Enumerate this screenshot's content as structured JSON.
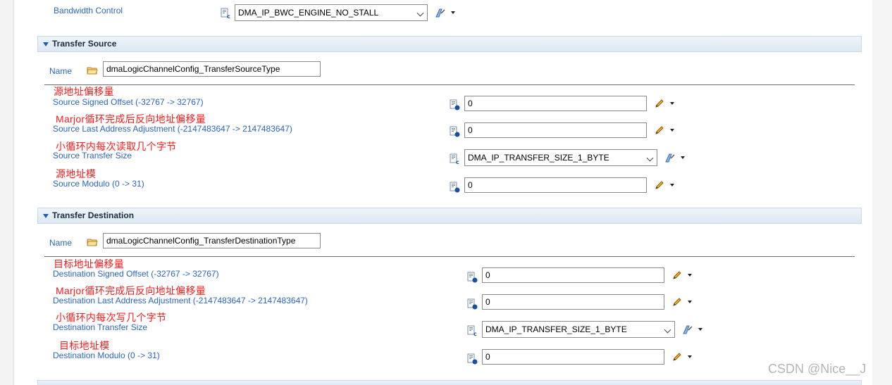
{
  "top": {
    "bandwidth_label": "Bandwidth Control",
    "bandwidth_value": "DMA_IP_BWC_ENGINE_NO_STALL"
  },
  "source": {
    "header": "Transfer Source",
    "name_label": "Name",
    "name_value": "dmaLogicChannelConfig_TransferSourceType",
    "fields": [
      {
        "note": "源地址偏移量",
        "label": "Source Signed Offset (-32767 -> 32767)",
        "value": "0"
      },
      {
        "note": "Marjor循环完成后反向地址偏移量",
        "label": "Source Last Address Adjustment (-2147483647 -> 2147483647)",
        "value": "0"
      },
      {
        "note": "小循环内每次读取几个字节",
        "label": "Source Transfer Size",
        "value": "DMA_IP_TRANSFER_SIZE_1_BYTE"
      },
      {
        "note": "源地址模",
        "label": "Source Modulo (0 -> 31)",
        "value": "0"
      }
    ]
  },
  "destination": {
    "header": "Transfer Destination",
    "name_label": "Name",
    "name_value": "dmaLogicChannelConfig_TransferDestinationType",
    "fields": [
      {
        "note": "目标地址偏移量",
        "label": "Destination Signed Offset (-32767 -> 32767)",
        "value": "0"
      },
      {
        "note": "Marjor循环完成后反向地址偏移量",
        "label": "Destination Last Address Adjustment (-2147483647 -> 2147483647)",
        "value": "0"
      },
      {
        "note": "小循环内每次写几个字节",
        "label": "Destination Transfer Size",
        "value": "DMA_IP_TRANSFER_SIZE_1_BYTE"
      },
      {
        "note": "目标地址模",
        "label": "Destination Modulo (0 -> 31)",
        "value": "0"
      }
    ]
  },
  "watermark": "CSDN @Nice__J",
  "icons": {
    "calc_value": "calculated-value-icon",
    "calc_combo": "calculated-enum-icon",
    "folder": "folder-icon",
    "edit": "pencil-icon",
    "param": "parameter-tool-icon",
    "dropdown": "chevron-down-icon"
  },
  "colors": {
    "label_blue": "#2a64c6",
    "note_red": "#ff1a1a",
    "header_bg": "#dde8f3"
  }
}
